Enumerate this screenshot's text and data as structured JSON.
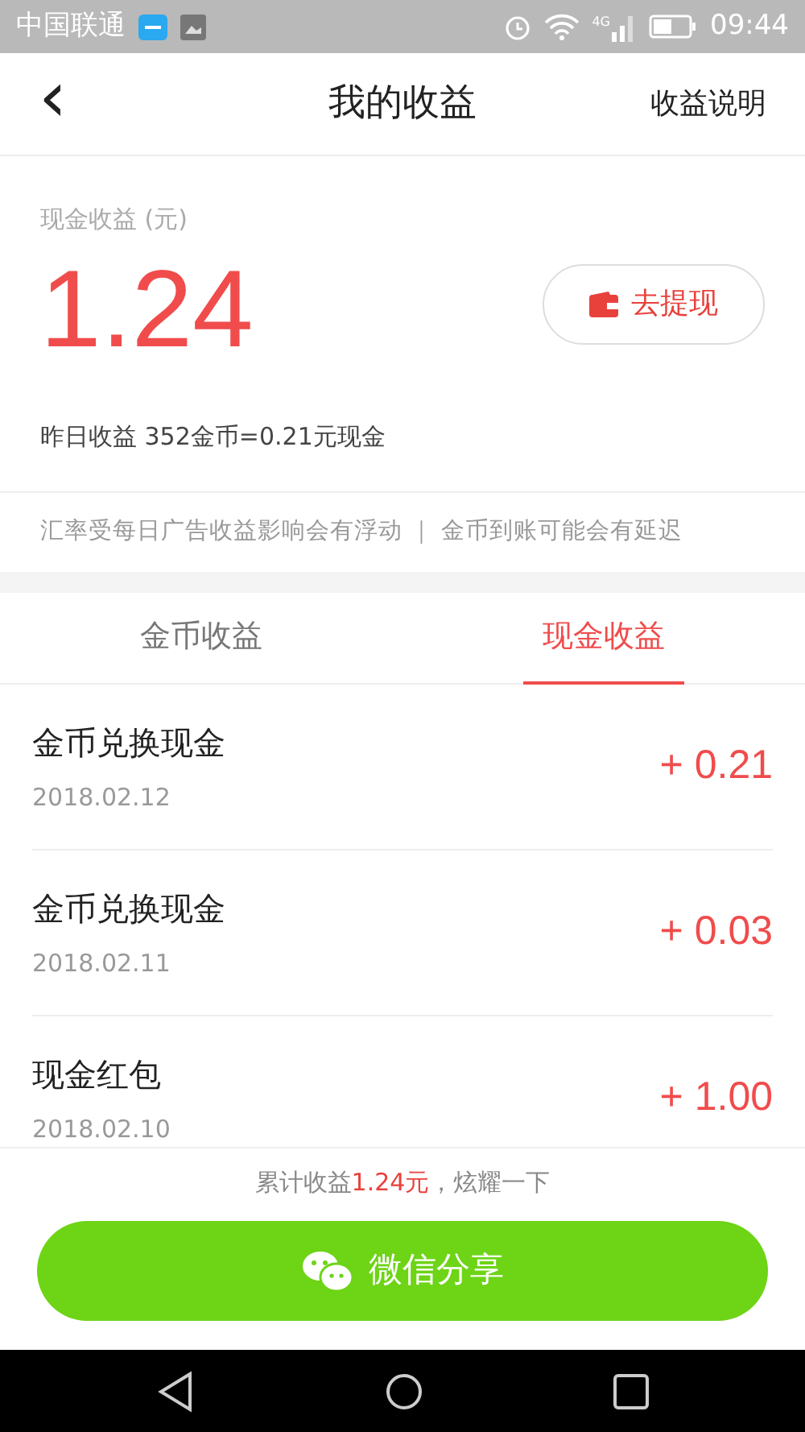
{
  "status_bar": {
    "carrier": "中国联通",
    "time": "09:44",
    "network": "4G"
  },
  "header": {
    "back": "‹",
    "title": "我的收益",
    "action": "收益说明"
  },
  "summary": {
    "label": "现金收益 (元)",
    "amount": "1.24",
    "withdraw_button": "去提现",
    "yesterday": "昨日收益 352金币=0.21元现金"
  },
  "notice": "汇率受每日广告收益影响会有浮动 ｜ 金币到账可能会有延迟",
  "tabs": [
    {
      "label": "金币收益",
      "selected": false
    },
    {
      "label": "现金收益",
      "selected": true
    }
  ],
  "records": [
    {
      "title": "金币兑换现金",
      "date": "2018.02.12",
      "amount": "+ 0.21"
    },
    {
      "title": "金币兑换现金",
      "date": "2018.02.11",
      "amount": "+ 0.03"
    },
    {
      "title": "现金红包",
      "date": "2018.02.10",
      "amount": "+ 1.00"
    }
  ],
  "footer": {
    "total_prefix": "累计收益",
    "total_amount": "1.24元",
    "total_suffix": "，炫耀一下",
    "share_button": "微信分享"
  }
}
